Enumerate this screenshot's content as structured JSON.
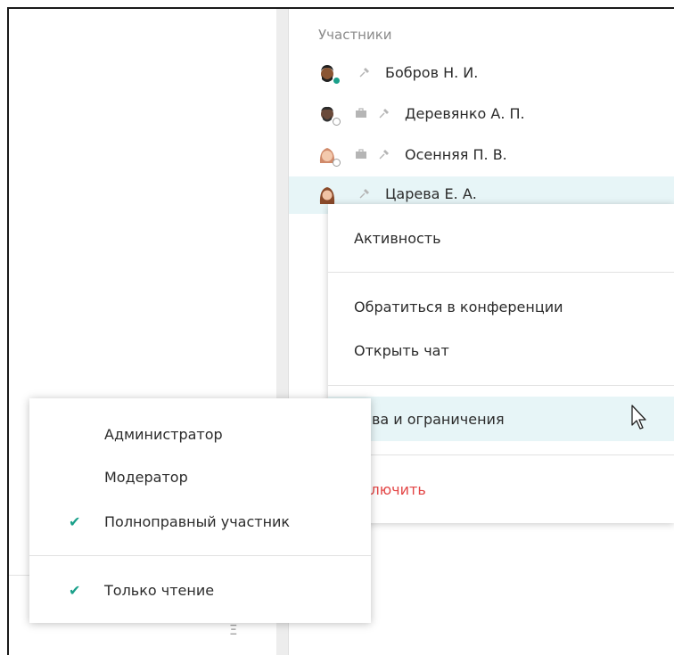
{
  "participants": {
    "title": "Участники",
    "members": [
      {
        "name": "Бобров Н. И.",
        "status": "online",
        "has_briefcase": false
      },
      {
        "name": "Деревянко А. П.",
        "status": "offline",
        "has_briefcase": true
      },
      {
        "name": "Осенняя П. В.",
        "status": "offline",
        "has_briefcase": true
      },
      {
        "name": "Царева Е. А.",
        "status": "none",
        "has_briefcase": false
      }
    ]
  },
  "context_menu": {
    "activity": "Активность",
    "mention_in_conference": "Обратиться в конференции",
    "open_chat": "Открыть чат",
    "rights_and_restrictions": "рава и ограничения",
    "exclude": "сключить"
  },
  "rights_submenu": {
    "items": [
      {
        "label": "Администратор",
        "checked": false
      },
      {
        "label": "Модератор",
        "checked": false
      },
      {
        "label": "Полноправный участник",
        "checked": true
      }
    ],
    "read_only": {
      "label": "Только чтение",
      "checked": true
    },
    "check_glyph": "✔"
  },
  "icons": {
    "pin": "✕",
    "briefcase": "briefcase-icon",
    "left_bottom": "Ξ"
  },
  "colors": {
    "accent": "#1aa08a",
    "danger": "#e34646",
    "selection": "#e7f5f7"
  }
}
